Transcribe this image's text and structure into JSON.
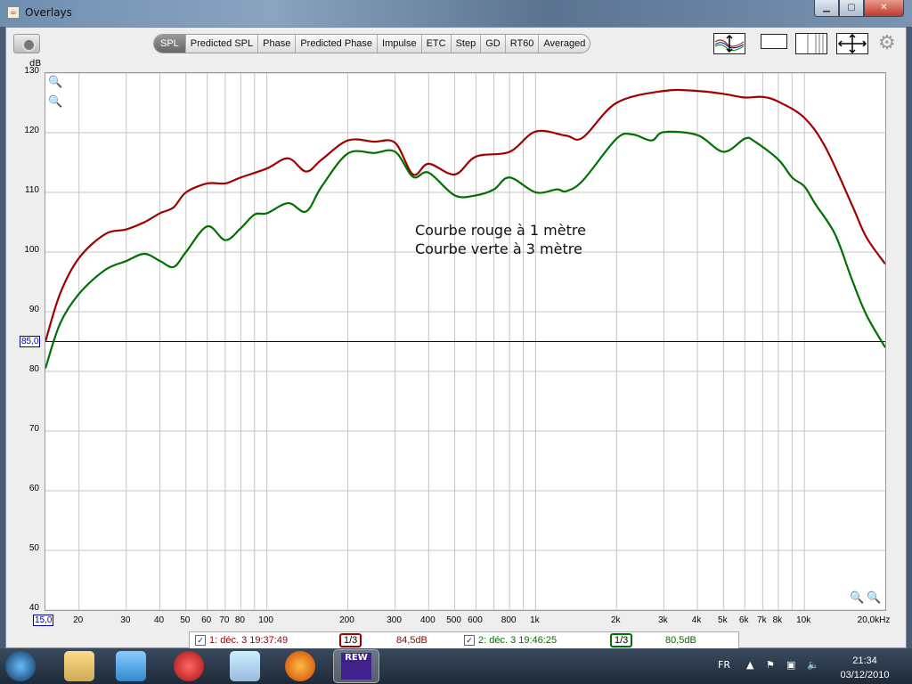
{
  "window": {
    "title": "Overlays"
  },
  "tabs": [
    "SPL",
    "Predicted SPL",
    "Phase",
    "Predicted Phase",
    "Impulse",
    "ETC",
    "Step",
    "GD",
    "RT60",
    "Averaged"
  ],
  "annotation": [
    "Courbe rouge à 1 mètre",
    "Courbe verte à 3 mètre"
  ],
  "reference_line": {
    "label": "85,0",
    "value": 85,
    "color": "#00008b"
  },
  "x_start_label": "15,0",
  "legend": [
    {
      "checked": true,
      "label": "1: déc. 3 19:37:49",
      "smoothing": "1/3",
      "level": "84,5dB",
      "color": "#a00000"
    },
    {
      "checked": true,
      "label": "2: déc. 3 19:46:25",
      "smoothing": "1/3",
      "level": "80,5dB",
      "color": "#007000"
    }
  ],
  "taskbar": {
    "language": "FR",
    "time": "21:34",
    "date": "03/12/2010",
    "active_app": "REW"
  },
  "chart_data": {
    "type": "line",
    "ylabel": "dB",
    "xscale": "log",
    "xlim": [
      15,
      20000
    ],
    "ylim": [
      40,
      130
    ],
    "grid": true,
    "yticks": [
      40,
      50,
      60,
      70,
      80,
      90,
      100,
      110,
      120,
      130
    ],
    "xtick_labels": [
      [
        20,
        "20"
      ],
      [
        30,
        "30"
      ],
      [
        40,
        "40"
      ],
      [
        50,
        "50"
      ],
      [
        60,
        "60"
      ],
      [
        70,
        "70"
      ],
      [
        80,
        "80"
      ],
      [
        100,
        "100"
      ],
      [
        200,
        "200"
      ],
      [
        300,
        "300"
      ],
      [
        400,
        "400"
      ],
      [
        500,
        "500"
      ],
      [
        600,
        "600"
      ],
      [
        800,
        "800"
      ],
      [
        1000,
        "1k"
      ],
      [
        2000,
        "2k"
      ],
      [
        3000,
        "3k"
      ],
      [
        4000,
        "4k"
      ],
      [
        5000,
        "5k"
      ],
      [
        6000,
        "6k"
      ],
      [
        7000,
        "7k"
      ],
      [
        8000,
        "8k"
      ],
      [
        10000,
        "10k"
      ],
      [
        20000,
        "20,0kHz"
      ]
    ],
    "series": [
      {
        "color": "#a00000",
        "x": [
          15,
          17,
          20,
          25,
          30,
          35,
          40,
          45,
          50,
          60,
          70,
          80,
          100,
          120,
          140,
          160,
          200,
          250,
          300,
          350,
          400,
          500,
          600,
          800,
          1000,
          1300,
          1500,
          2000,
          3000,
          4000,
          5000,
          6000,
          7000,
          8000,
          10000,
          12000,
          15000,
          17000,
          20000
        ],
        "y": [
          85,
          93,
          99,
          103,
          103.8,
          105,
          106.5,
          107.5,
          110,
          111.5,
          111.5,
          112.5,
          114,
          115.7,
          113.5,
          115.5,
          118.7,
          118.5,
          118.3,
          113,
          114.8,
          113,
          116,
          116.8,
          120.2,
          119.5,
          119.2,
          125,
          127,
          127,
          126.5,
          125.9,
          126,
          125.2,
          122.5,
          117.5,
          108,
          102.5,
          98
        ]
      },
      {
        "color": "#007000",
        "x": [
          15,
          17,
          20,
          25,
          30,
          35,
          40,
          45,
          50,
          60,
          70,
          80,
          90,
          100,
          120,
          140,
          160,
          200,
          250,
          300,
          350,
          400,
          500,
          600,
          700,
          800,
          1000,
          1200,
          1300,
          1500,
          2000,
          2300,
          2700,
          3000,
          4000,
          5000,
          6000,
          6500,
          8000,
          9000,
          10000,
          11000,
          13000,
          15000,
          17000,
          20000
        ],
        "y": [
          80.5,
          88,
          93,
          97,
          98.5,
          99.7,
          98.5,
          97.5,
          100,
          104.3,
          102,
          104,
          106.3,
          106.5,
          108.2,
          106.8,
          111,
          116.5,
          116.6,
          116.8,
          112.6,
          113.3,
          109.5,
          109.5,
          110.5,
          112.5,
          110,
          110.5,
          110.2,
          112,
          119,
          119.7,
          118.7,
          120.1,
          119.6,
          116.8,
          119,
          118.6,
          115.5,
          112.5,
          111,
          108,
          103,
          95.5,
          89.5,
          84
        ]
      }
    ]
  }
}
